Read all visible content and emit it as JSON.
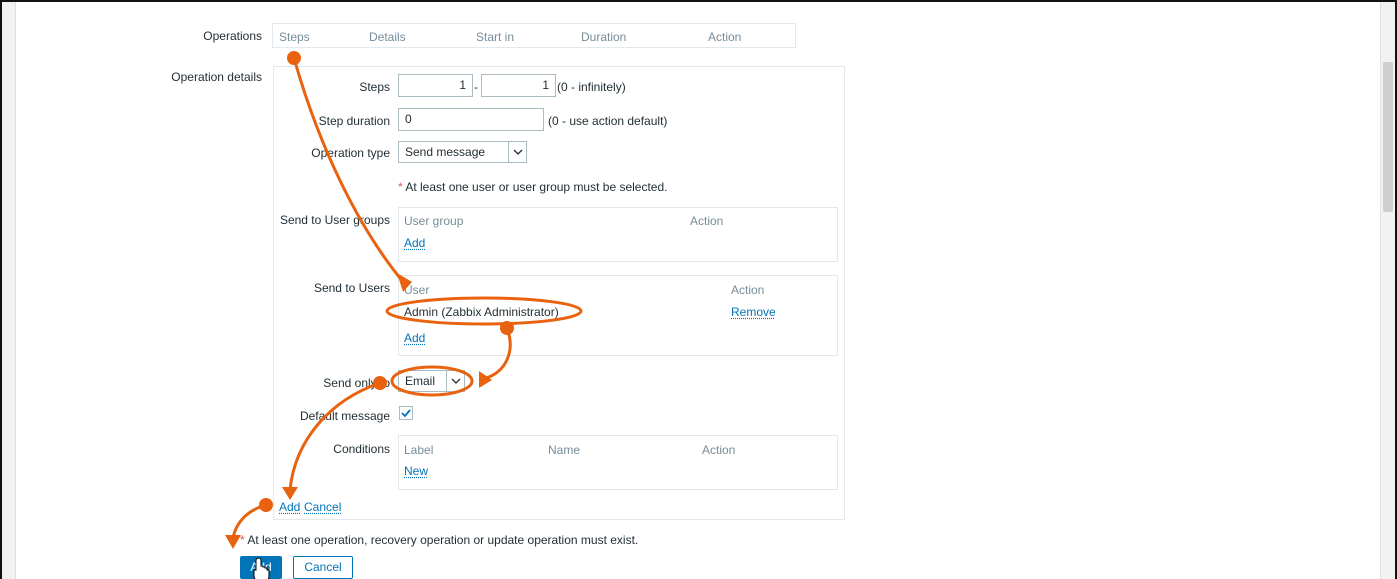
{
  "labels": {
    "operations": "Operations",
    "operation_details": "Operation details",
    "steps": "Steps",
    "step_duration": "Step duration",
    "operation_type": "Operation type",
    "send_to_user_groups": "Send to User groups",
    "send_to_users": "Send to Users",
    "send_only_to": "Send only to",
    "default_message": "Default message",
    "conditions": "Conditions"
  },
  "operations_table": {
    "headers": [
      "Steps",
      "Details",
      "Start in",
      "Duration",
      "Action"
    ]
  },
  "steps": {
    "from": "1",
    "separator": "-",
    "to": "1",
    "hint": "(0 - infinitely)"
  },
  "step_duration": {
    "value": "0",
    "hint": "(0 - use action default)"
  },
  "operation_type": {
    "selected": "Send message"
  },
  "requirement_note": {
    "star": "*",
    "text": "At least one user or user group must be selected."
  },
  "user_groups": {
    "headers": [
      "User group",
      "Action"
    ],
    "add_link": "Add"
  },
  "users": {
    "headers": [
      "User",
      "Action"
    ],
    "rows": [
      {
        "name": "Admin (Zabbix Administrator)",
        "action": "Remove"
      }
    ],
    "add_link": "Add"
  },
  "send_only_to": {
    "selected": "Email"
  },
  "default_message": {
    "checked": true
  },
  "conditions": {
    "headers": [
      "Label",
      "Name",
      "Action"
    ],
    "new_link": "New"
  },
  "operation_actions": {
    "add": "Add",
    "cancel": "Cancel"
  },
  "bottom_note": {
    "star": "*",
    "text": "At least one operation, recovery operation or update operation must exist."
  },
  "form_buttons": {
    "add": "Add",
    "cancel": "Cancel"
  },
  "colors": {
    "accent": "#0275b8",
    "annotation": "#e8620f",
    "required": "#e45959"
  },
  "icons": {
    "dropdown": "chevron-down-icon",
    "checkbox": "checkmark-icon",
    "cursor": "hand-pointer-icon"
  }
}
